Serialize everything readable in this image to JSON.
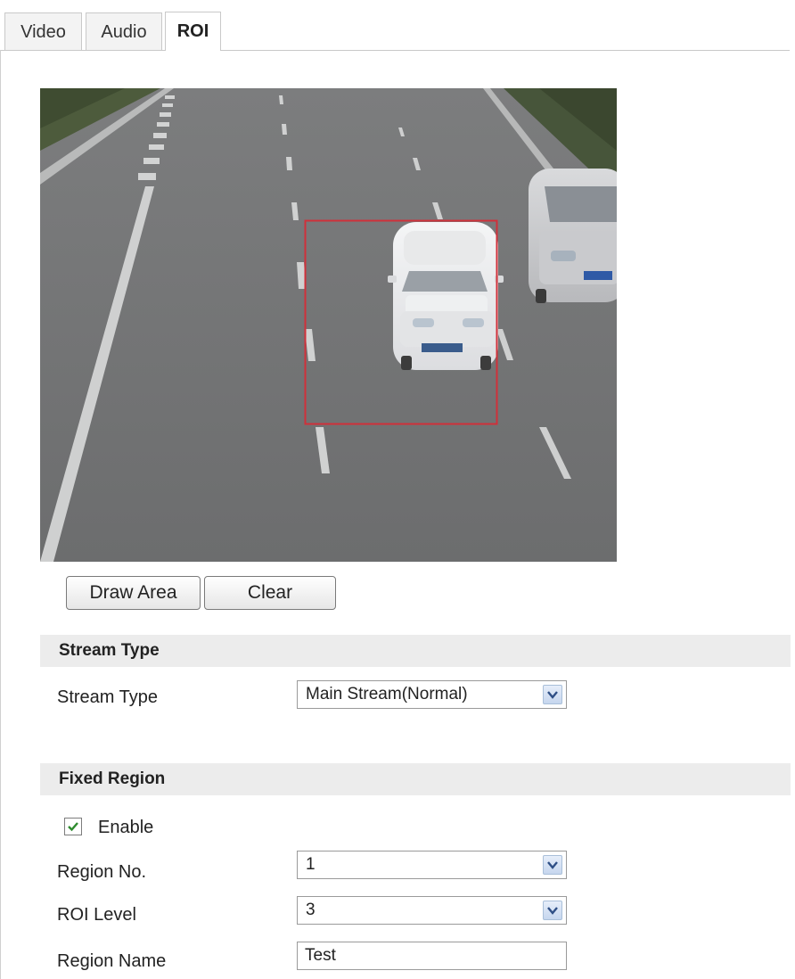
{
  "tabs": [
    {
      "label": "Video",
      "active": false
    },
    {
      "label": "Audio",
      "active": false
    },
    {
      "label": "ROI",
      "active": true
    }
  ],
  "preview": {
    "roi_box_color": "#d0303a"
  },
  "buttons": {
    "draw_area": "Draw Area",
    "clear": "Clear"
  },
  "stream_type_section": {
    "title": "Stream Type",
    "stream_type_label": "Stream Type",
    "stream_type_value": "Main Stream(Normal)"
  },
  "fixed_region_section": {
    "title": "Fixed Region",
    "enable_label": "Enable",
    "enable_checked": true,
    "region_no_label": "Region No.",
    "region_no_value": "1",
    "roi_level_label": "ROI Level",
    "roi_level_value": "3",
    "region_name_label": "Region Name",
    "region_name_value": "Test"
  },
  "colors": {
    "section_bg": "#ececec",
    "dropdown_arrow_bg": "#c6d6ee",
    "checkbox_check": "#2e8b2e"
  }
}
